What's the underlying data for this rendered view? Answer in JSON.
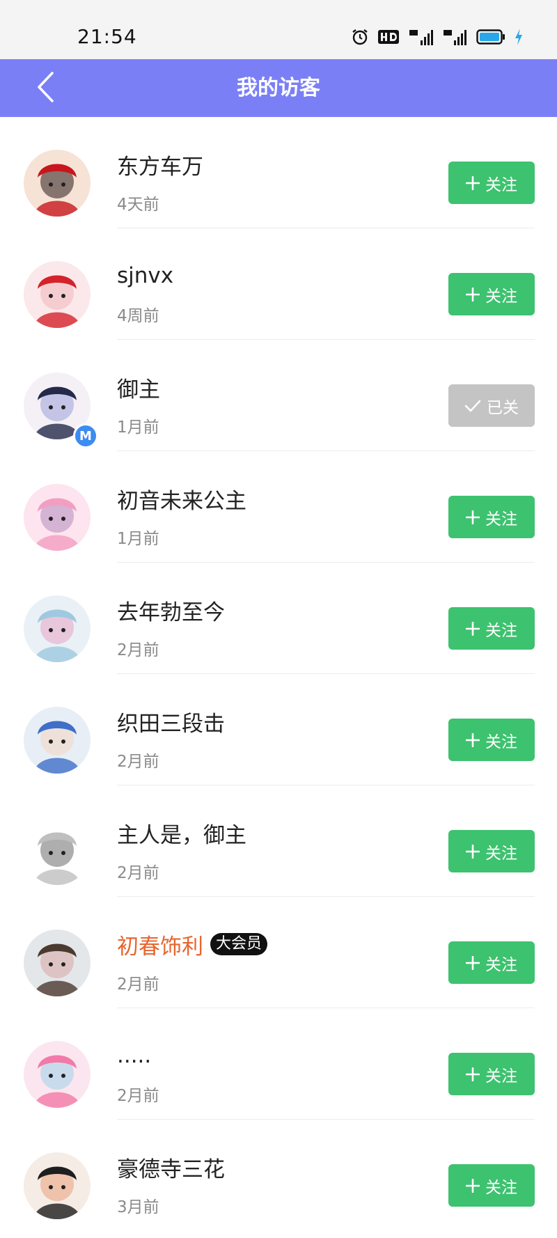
{
  "status_bar": {
    "time": "21:54",
    "icons": [
      "alarm-icon",
      "hd-icon",
      "5g-signal-icon",
      "4g-signal-icon",
      "battery-icon",
      "charging-icon"
    ]
  },
  "header": {
    "title": "我的访客",
    "back_icon": "chevron-left-icon",
    "background_color": "#7b7ff5"
  },
  "colors": {
    "follow_button": "#3dc26f",
    "followed_button": "#c4c4c4",
    "vip_name": "#e8652f"
  },
  "visitors": [
    {
      "name": "东方车万",
      "time": "4天前",
      "button_label": "关注",
      "followed": false
    },
    {
      "name": "sjnvx",
      "time": "4周前",
      "button_label": "关注",
      "followed": false
    },
    {
      "name": "御主",
      "time": "1月前",
      "button_label": "已关",
      "followed": true,
      "badge": "M"
    },
    {
      "name": "初音未来公主",
      "time": "1月前",
      "button_label": "关注",
      "followed": false
    },
    {
      "name": "去年勃至今",
      "time": "2月前",
      "button_label": "关注",
      "followed": false
    },
    {
      "name": "织田三段击",
      "time": "2月前",
      "button_label": "关注",
      "followed": false
    },
    {
      "name": "主人是，御主",
      "time": "2月前",
      "button_label": "关注",
      "followed": false
    },
    {
      "name": "初春饰利",
      "time": "2月前",
      "button_label": "关注",
      "followed": false,
      "tag": "大会员",
      "vip": true
    },
    {
      "name": ".....",
      "time": "2月前",
      "button_label": "关注",
      "followed": false
    },
    {
      "name": "豪德寺三花",
      "time": "3月前",
      "button_label": "关注",
      "followed": false
    }
  ]
}
